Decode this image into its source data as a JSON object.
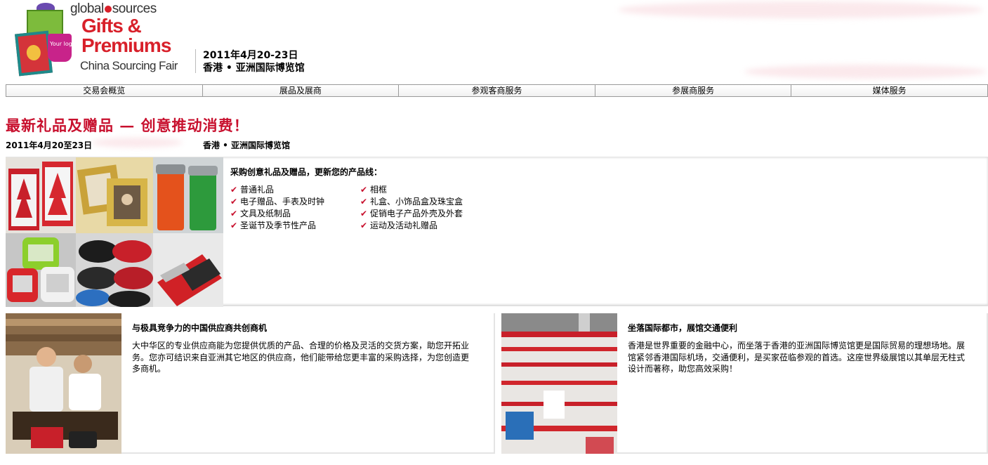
{
  "brand": {
    "global": "global",
    "sources": "sources",
    "title_line1": "Gifts &",
    "title_line2": "Premiums",
    "subtitle": "China Sourcing Fair",
    "mug_text": "Your logo"
  },
  "header": {
    "event_date": "2011年4月20-23日",
    "event_venue": "香港 • 亚洲国际博览馆"
  },
  "nav": {
    "items": [
      "交易会概览",
      "展品及展商",
      "参观客商服务",
      "参展商服务",
      "媒体服务"
    ]
  },
  "main": {
    "headline": "最新礼品及赠品 — 创意推动消费！",
    "date": "2011年4月20至23日",
    "venue": "香港 • 亚洲国际博览馆"
  },
  "products": {
    "heading": "采购创意礼品及赠品，更新您的产品线：",
    "col1": [
      "普通礼品",
      "电子赠品、手表及时钟",
      "文具及纸制品",
      "圣诞节及季节性产品"
    ],
    "col2": [
      "相框",
      "礼盒、小饰品盒及珠宝盒",
      "促销电子产品外壳及外套",
      "运动及活动礼赠品"
    ]
  },
  "cards": [
    {
      "title": "与极具竞争力的中国供应商共创商机",
      "body_lines": [
        "大中华区的专业供应商能为您提供优质的产品、合理的价格及灵活的交货方案，助您开拓业",
        "务。您亦可结识来自亚洲其它地区的供应商，他们能带给您更丰富的采购选择，为您创造更",
        "多商机。"
      ]
    },
    {
      "title": "坐落国际都市，展馆交通便利",
      "body_lines": [
        "香港是世界重要的金融中心，而坐落于香港的亚洲国际博览馆更是国际贸易的理想场地。展",
        "馆紧邻香港国际机场，交通便利，是买家莅临参观的首选。这座世界级展馆以其单层无柱式",
        "设计而著称，助您高效采购！"
      ]
    }
  ],
  "colors": {
    "accent_red": "#c8102e",
    "nav_border": "#9a9a9a"
  }
}
